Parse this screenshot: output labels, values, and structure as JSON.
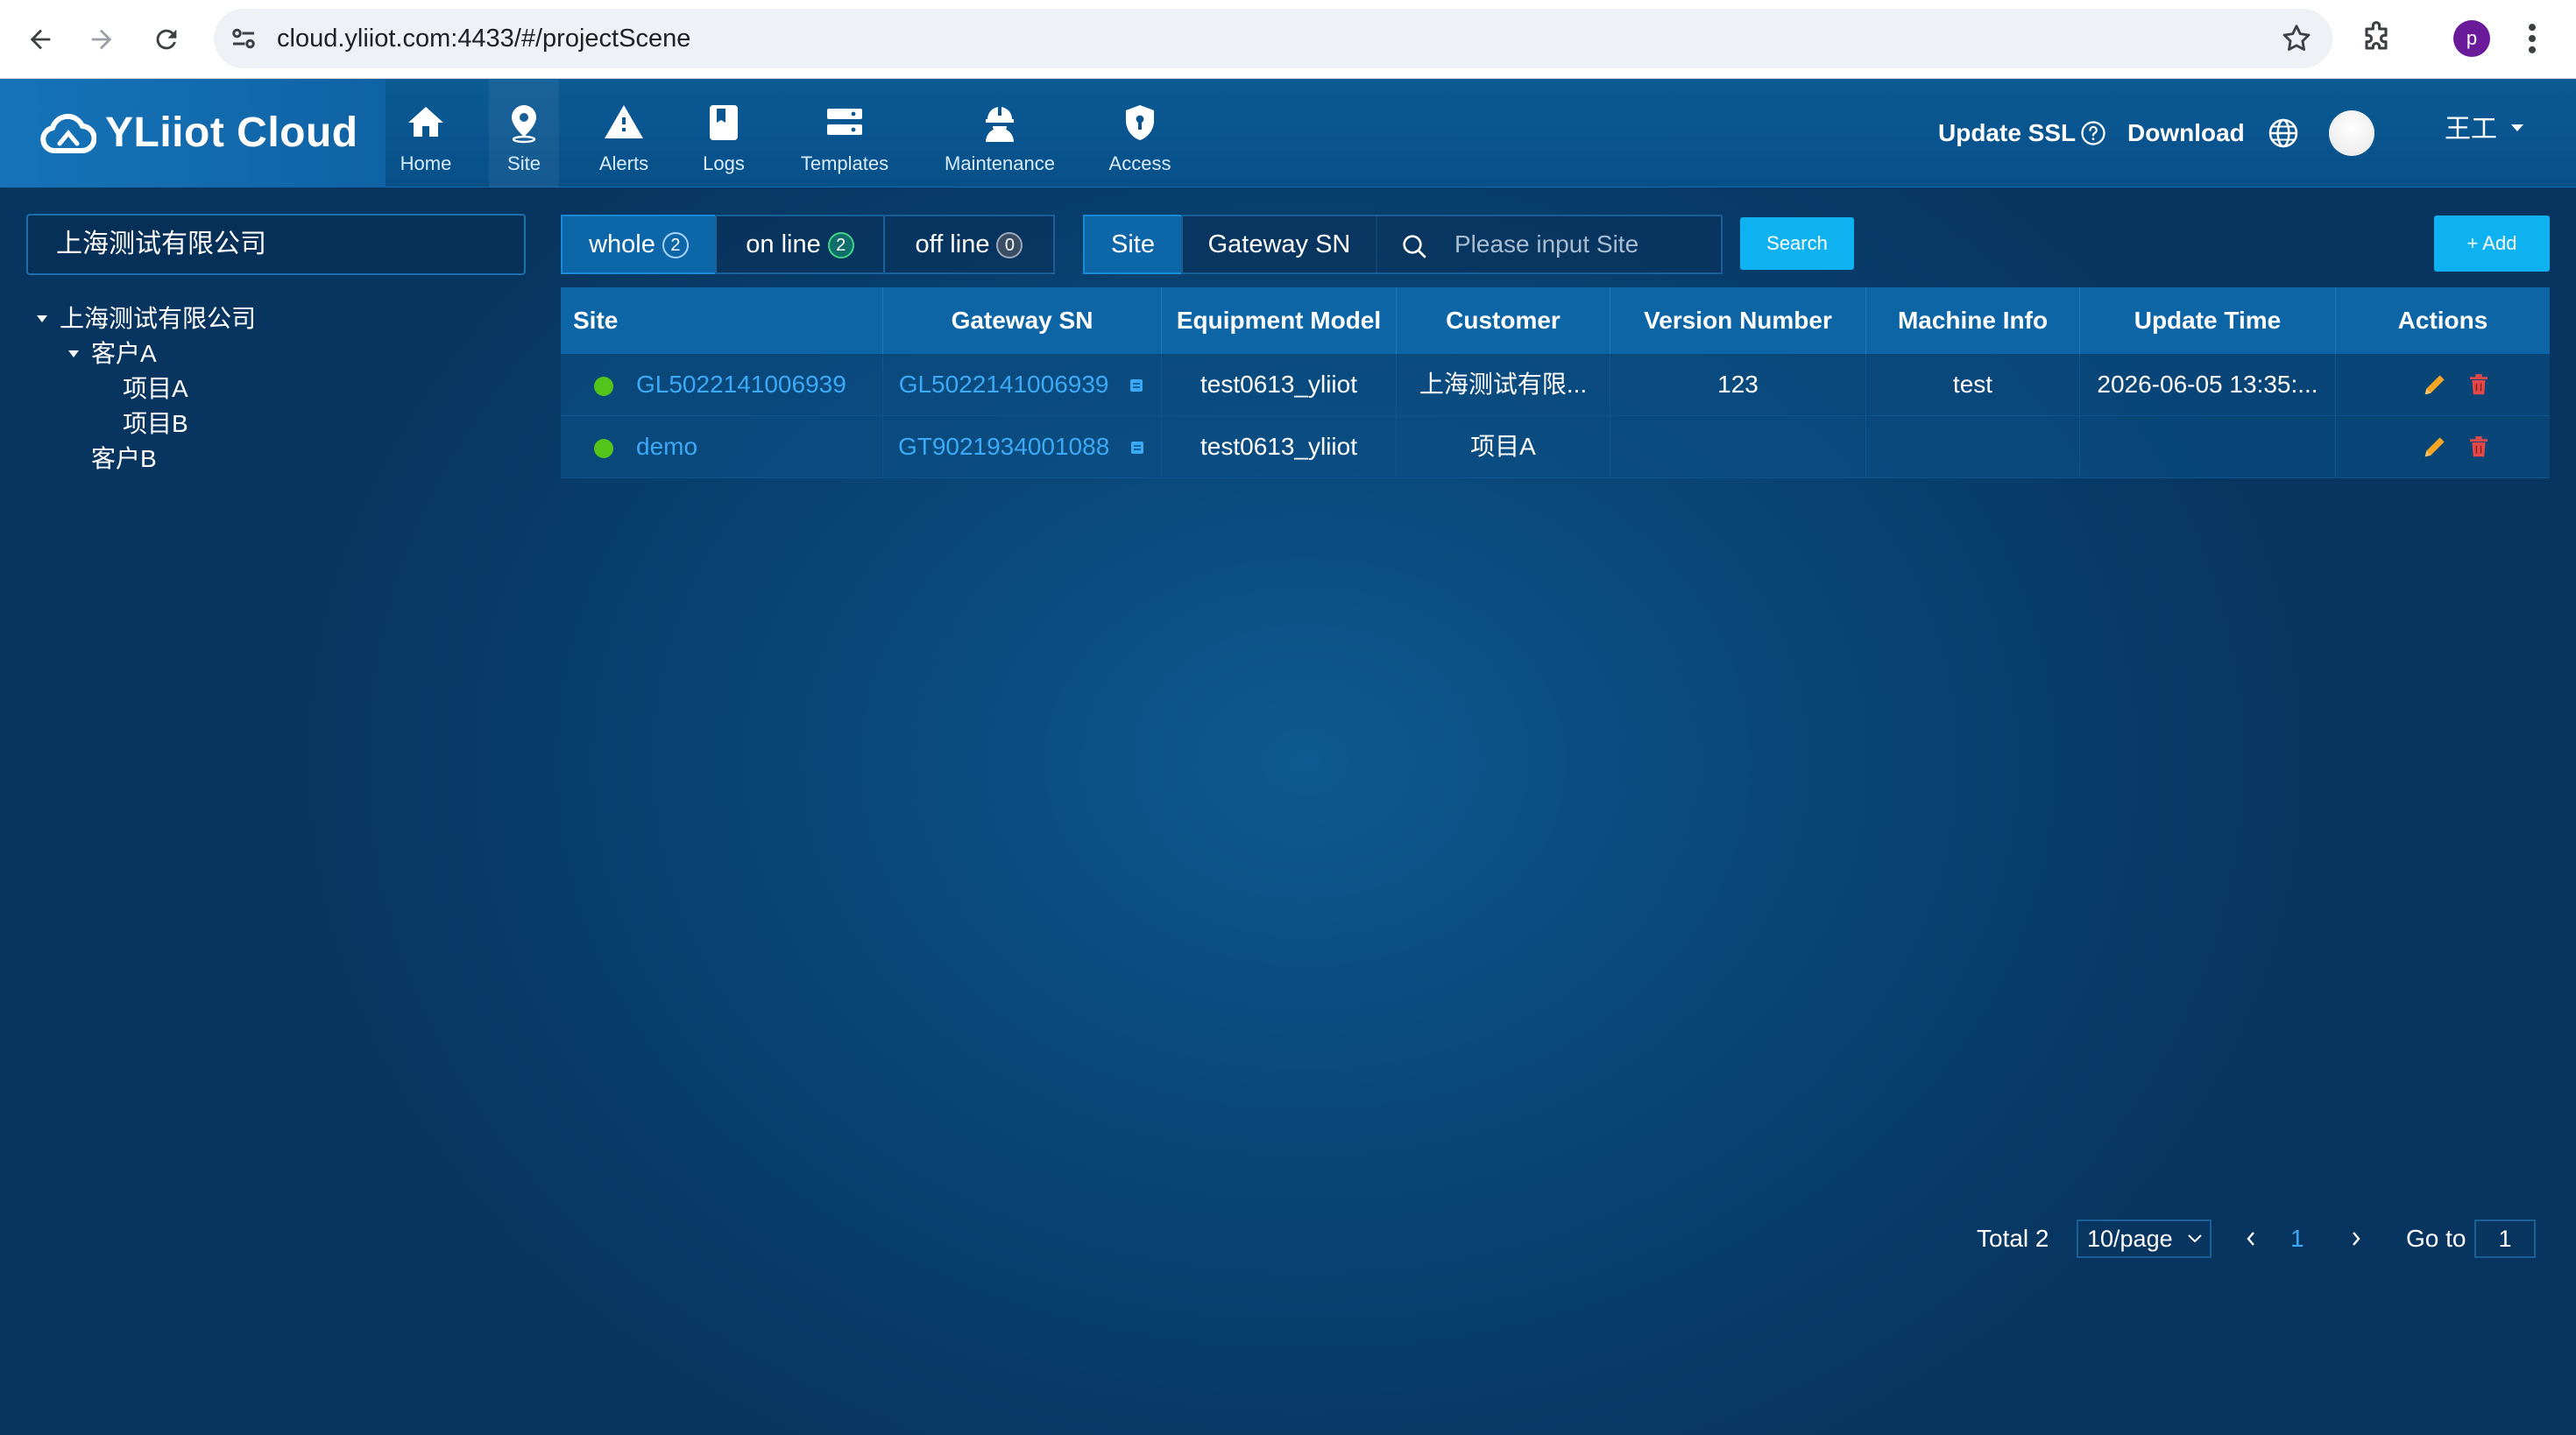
{
  "browser": {
    "url": "cloud.yliiot.com:4433/#/projectScene",
    "profile_initial": "p"
  },
  "header": {
    "brand": "YLiiot Cloud",
    "nav": [
      {
        "label": "Home"
      },
      {
        "label": "Site"
      },
      {
        "label": "Alerts"
      },
      {
        "label": "Logs"
      },
      {
        "label": "Templates"
      },
      {
        "label": "Maintenance"
      },
      {
        "label": "Access"
      }
    ],
    "active_nav": "Site",
    "update_ssl": "Update SSL",
    "download": "Download",
    "user_name": "王工",
    "colors": {
      "header_bg": "#08508a",
      "accent": "#0fb2f0",
      "link": "#3ba9f5",
      "online": "#52c41a"
    }
  },
  "sidebar": {
    "company_select": "上海测试有限公司",
    "tree": [
      {
        "label": "上海测试有限公司",
        "level": 0,
        "expanded": true
      },
      {
        "label": "客户A",
        "level": 1,
        "expanded": true
      },
      {
        "label": "项目A",
        "level": 2
      },
      {
        "label": "项目B",
        "level": 2
      },
      {
        "label": "客户B",
        "level": 1
      }
    ]
  },
  "filters": {
    "status_tabs": [
      {
        "label": "whole",
        "count": "2",
        "active": true
      },
      {
        "label": "on line",
        "count": "2"
      },
      {
        "label": "off line",
        "count": "0"
      }
    ],
    "field_tabs": [
      {
        "label": "Site",
        "active": true
      },
      {
        "label": "Gateway SN"
      }
    ],
    "search_placeholder": "Please input Site",
    "search_button": "Search",
    "add_button": "+ Add"
  },
  "table": {
    "columns": [
      "Site",
      "Gateway SN",
      "Equipment Model",
      "Customer",
      "Version Number",
      "Machine Info",
      "Update Time",
      "Actions"
    ],
    "rows": [
      {
        "site": "GL5022141006939",
        "gateway_sn": "GL5022141006939",
        "model": "test0613_yliiot",
        "customer": "上海测试有限...",
        "version": "123",
        "machine": "test",
        "update_time": "2026-06-05 13:35:...",
        "online": true
      },
      {
        "site": "demo",
        "gateway_sn": "GT9021934001088",
        "model": "test0613_yliiot",
        "customer": "项目A",
        "version": "",
        "machine": "",
        "update_time": "",
        "online": true
      }
    ]
  },
  "pagination": {
    "total_label": "Total 2",
    "page_size": "10/page",
    "current_page": "1",
    "goto_label": "Go to",
    "goto_value": "1"
  }
}
